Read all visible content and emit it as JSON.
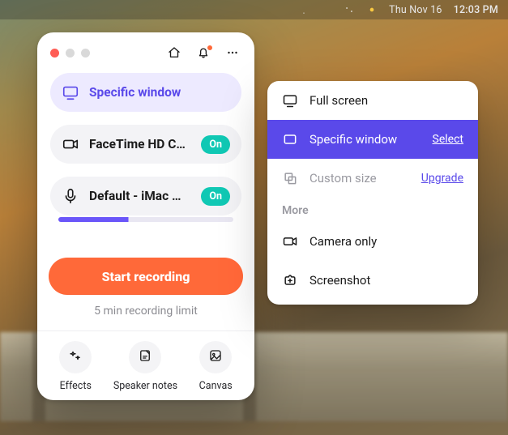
{
  "menubar": {
    "date": "Thu Nov 16",
    "time": "12:03 PM"
  },
  "card": {
    "source": {
      "icon": "monitor-icon",
      "label": "Specific window"
    },
    "camera": {
      "icon": "camera-icon",
      "label": "FaceTime HD Ca...",
      "chip": "On"
    },
    "mic": {
      "icon": "mic-icon",
      "label": "Default - iMac Mi...",
      "chip": "On"
    },
    "start": "Start recording",
    "limit": "5 min recording limit",
    "footer": {
      "effects": "Effects",
      "speaker": "Speaker notes",
      "canvas": "Canvas"
    }
  },
  "menu": {
    "fullscreen": "Full screen",
    "specific": {
      "label": "Specific window",
      "action": "Select"
    },
    "custom": {
      "label": "Custom size",
      "action": "Upgrade"
    },
    "more": "More",
    "cameraOnly": "Camera only",
    "screenshot": "Screenshot"
  },
  "colors": {
    "accent": "#5a4ae3",
    "primary": "#ff6a3d",
    "chip": "#17c6b3"
  }
}
